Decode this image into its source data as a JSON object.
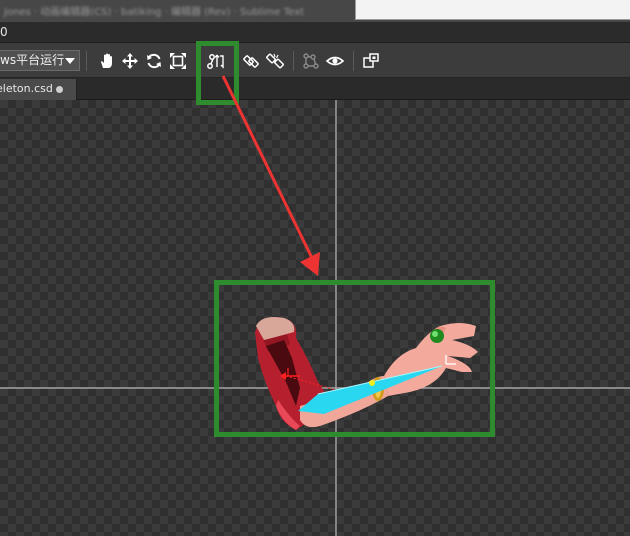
{
  "window": {
    "title": "Jones · 动画编辑器(CS) · batiking · 编辑器 (Rev) · Sublime Text"
  },
  "menubar": {
    "partial_label": "0"
  },
  "toolbar": {
    "platform_select_value": "ws平台运行",
    "tools": [
      {
        "name": "hand-tool",
        "icon": "hand-icon"
      },
      {
        "name": "move-tool",
        "icon": "move-arrows-icon"
      },
      {
        "name": "rotate-tool",
        "icon": "rotate-icon"
      },
      {
        "name": "scale-tool",
        "icon": "scale-icon"
      },
      {
        "name": "create-bone-tool",
        "icon": "create-bone-icon"
      },
      {
        "name": "bind-bone-tool",
        "icon": "bind-bone-icon"
      },
      {
        "name": "unbind-bone-tool",
        "icon": "unbind-bone-icon"
      },
      {
        "name": "skeleton-tool",
        "icon": "skeleton-icon"
      },
      {
        "name": "visibility-tool",
        "icon": "eye-icon"
      },
      {
        "name": "transform-tool",
        "icon": "transform-icon"
      }
    ]
  },
  "tabs": [
    {
      "label": "eleton.csd",
      "modified": true
    }
  ],
  "annotations": {
    "highlight_color": "#2e8b2e",
    "arrow_color": "#ee3333"
  },
  "canvas": {
    "bone_color": "#2ad7f0"
  }
}
